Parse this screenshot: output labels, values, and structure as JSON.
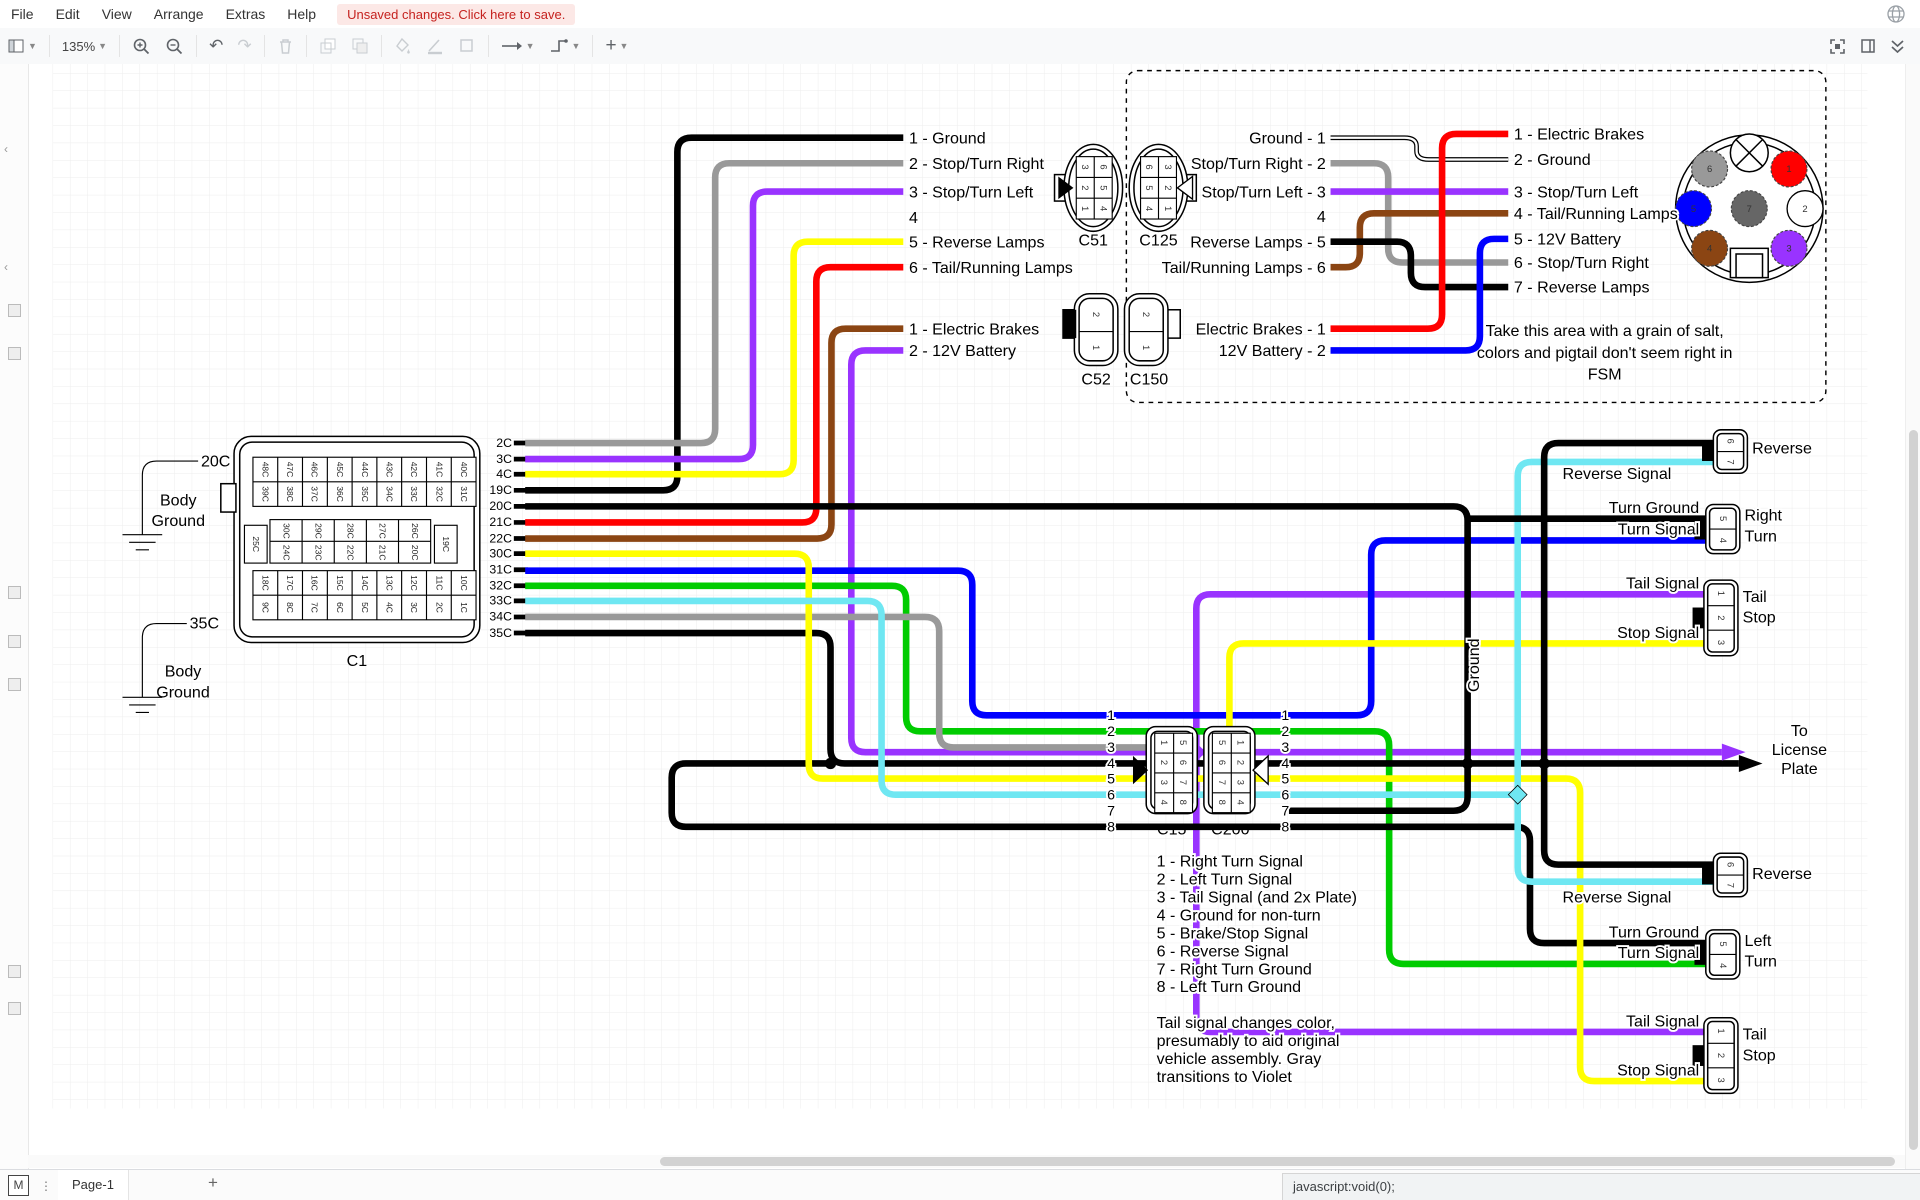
{
  "menu": {
    "items": [
      "File",
      "Edit",
      "View",
      "Arrange",
      "Extras",
      "Help"
    ],
    "unsaved_notice": "Unsaved changes. Click here to save."
  },
  "toolbar": {
    "zoom_level": "135%"
  },
  "footer": {
    "logo": "M",
    "page_tab": "Page-1",
    "status_text": "javascript:void(0);"
  },
  "colors": {
    "ground_black": "#000000",
    "gray_wire": "#999999",
    "purple_wire": "#9933ff",
    "yellow_wire": "#ffff00",
    "red_wire": "#ff0000",
    "brown_wire": "#8b4513",
    "blue_wire": "#0000ff",
    "green_wire": "#00cc00",
    "cyan_wire": "#6fe7f2",
    "white_wire": "#ffffff",
    "dark_gray_pin": "#666666",
    "unsaved_bg": "#fce8e6",
    "unsaved_text": "#c5221f"
  },
  "diagram": {
    "left_pigtail": [
      "1 - Ground",
      "2 - Stop/Turn Right",
      "3 - Stop/Turn Left",
      "4",
      "5 - Reverse Lamps",
      "6 - Tail/Running Lamps"
    ],
    "left_brakes": [
      "1 - Electric Brakes",
      "2 - 12V Battery"
    ],
    "mid_pigtail": [
      "Ground - 1",
      "Stop/Turn Right - 2",
      "Stop/Turn Left - 3",
      "4",
      "Reverse Lamps - 5",
      "Tail/Running Lamps - 6"
    ],
    "mid_brakes": [
      "Electric Brakes - 1",
      "12V Battery - 2"
    ],
    "right_pigtail": [
      "1 - Electric Brakes",
      "2 - Ground",
      "3 - Stop/Turn Left",
      "4 - Tail/Running Lamps",
      "5 - 12V Battery",
      "6 - Stop/Turn Right",
      "7 - Reverse Lamps"
    ],
    "note_fsm": [
      "Take this area with a grain of salt,",
      "colors and pigtail don't seem right in",
      "FSM"
    ],
    "connectors": {
      "c51": "C51",
      "c125": "C125",
      "c52": "C52",
      "c150": "C150",
      "c15": "C15",
      "c200": "C200"
    },
    "c51_pins_left": [
      "3",
      "2",
      "1"
    ],
    "c51_pins_right": [
      "6",
      "5",
      "4"
    ],
    "c125_pins_left": [
      "6",
      "5",
      "4"
    ],
    "c125_pins_right": [
      "3",
      "2",
      "1"
    ],
    "c52_pins": [
      "2",
      "1"
    ],
    "c150_pins": [
      "2",
      "1"
    ],
    "c15_pins_left": [
      "1",
      "2",
      "3",
      "4"
    ],
    "c15_pins_right": [
      "5",
      "6",
      "7",
      "8"
    ],
    "c200_pins_left": [
      "5",
      "6",
      "7",
      "8"
    ],
    "c200_pins_right": [
      "1",
      "2",
      "3",
      "4"
    ],
    "c1": {
      "label": "C1",
      "ground_top": "20C",
      "ground_bottom": "35C",
      "body_ground": [
        "Body",
        "Ground"
      ],
      "top_row": [
        "48C",
        "47C",
        "46C",
        "45C",
        "44C",
        "43C",
        "42C",
        "41C",
        "40C"
      ],
      "top_row2": [
        "39C",
        "38C",
        "37C",
        "36C",
        "35C",
        "34C",
        "33C",
        "32C",
        "31C"
      ],
      "mid_left": "25C",
      "mid_row": [
        "30C",
        "29C",
        "28C",
        "27C",
        "26C"
      ],
      "mid_row2": [
        "24C",
        "23C",
        "22C",
        "21C",
        "20C"
      ],
      "mid_right": "19C",
      "bot_row": [
        "18C",
        "17C",
        "16C",
        "15C",
        "14C",
        "13C",
        "12C",
        "11C",
        "10C"
      ],
      "bot_row2": [
        "9C",
        "8C",
        "7C",
        "6C",
        "5C",
        "4C",
        "3C",
        "2C",
        "1C"
      ],
      "stubs": [
        "2C",
        "3C",
        "4C",
        "19C",
        "20C",
        "21C",
        "22C",
        "30C",
        "31C",
        "32C",
        "33C",
        "34C",
        "35C"
      ],
      "stub_wire_colors": {
        "2C": "gray",
        "3C": "purple",
        "4C": "yellow",
        "19C": "black",
        "20C": "black",
        "21C": "red",
        "22C": "brown",
        "30C": "yellow",
        "31C": "blue",
        "32C": "green",
        "33C": "cyan",
        "34C": "gray",
        "35C": "black"
      }
    },
    "pin_numbers": [
      "1",
      "2",
      "3",
      "4",
      "5",
      "6",
      "7",
      "8"
    ],
    "pin_functions": [
      "1 - Right Turn Signal",
      "2 - Left Turn Signal",
      "3 - Tail Signal (and 2x Plate)",
      "4 - Ground for non-turn",
      "5 - Brake/Stop Signal",
      "6 - Reverse Signal",
      "7 - Right Turn Ground",
      "8 - Left Turn Ground"
    ],
    "note_tail": [
      "Tail signal changes color,",
      "presumably to aid original",
      "vehicle assembly.  Gray",
      "transitions to Violet"
    ],
    "lamps": {
      "reverse": "Reverse",
      "reverse_signal": "Reverse Signal",
      "right_turn": [
        "Right",
        "Turn"
      ],
      "left_turn": [
        "Left",
        "Turn"
      ],
      "turn_ground": "Turn Ground",
      "turn_signal": "Turn Signal",
      "tail_stop": [
        "Tail",
        "Stop"
      ],
      "tail_signal": "Tail Signal",
      "stop_signal": "Stop Signal",
      "license": [
        "To",
        "License",
        "Plate"
      ],
      "ground_vertical": "Ground",
      "reverse_pins": [
        "6",
        "7"
      ],
      "turn_pins": [
        "5",
        "4"
      ],
      "tail_pins": [
        "1",
        "2",
        "3"
      ]
    },
    "trailer_connector": {
      "pins": [
        "1",
        "2",
        "3",
        "4",
        "5",
        "6",
        "7"
      ],
      "pin_colors": {
        "1": "red",
        "2": "white",
        "3": "purple",
        "4": "brown",
        "5": "blue",
        "6": "gray",
        "7": "dark-gray"
      }
    }
  }
}
